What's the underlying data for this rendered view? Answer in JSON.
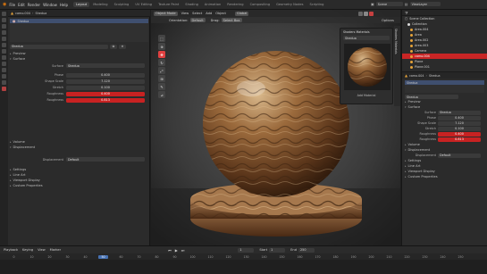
{
  "topbar": {
    "menus": [
      "File",
      "Edit",
      "Render",
      "Window",
      "Help"
    ],
    "workspaces": [
      "Layout",
      "Modeling",
      "Sculpting",
      "UV Editing",
      "Texture Paint",
      "Shading",
      "Animation",
      "Rendering",
      "Compositing",
      "Geometry Nodes",
      "Scripting"
    ],
    "active_workspace": "Layout",
    "scene": "Scene",
    "view_layer": "ViewLayer"
  },
  "left": {
    "object_name": "camo.004",
    "material_name": "Shedua",
    "material_field": "Shedua",
    "sections": {
      "preview": "Preview",
      "surface": "Surface",
      "volume": "Volume",
      "displacement": "Displacement",
      "settings": "Settings",
      "line_art": "Line Art",
      "viewport_display": "Viewport Display",
      "custom_properties": "Custom Properties"
    },
    "surface_label": "Surface",
    "surface_value": "Shedua",
    "props": [
      {
        "label": "Phase",
        "value": "0.400",
        "red": false
      },
      {
        "label": "Shape Scale",
        "value": "7.120",
        "red": false
      },
      {
        "label": "Stretch",
        "value": "0.100",
        "red": false
      },
      {
        "label": "Roughness",
        "value": "0.400",
        "red": true
      },
      {
        "label": "Roughness",
        "value": "0.813",
        "red": true
      }
    ],
    "displacement_label": "Displacement",
    "displacement_value": "Default"
  },
  "viewport": {
    "mode": "Object Mode",
    "menus": [
      "View",
      "Select",
      "Add",
      "Object"
    ],
    "orientation_label": "Orientation:",
    "orientation_value": "Default",
    "drag_label": "Drag:",
    "drag_value": "Select Box",
    "transform": "Global",
    "options": "Options",
    "popup": {
      "title": "Shaders Materials",
      "field": "Shedua",
      "caption": "Add Material"
    },
    "side_tab": "Shaders Materials"
  },
  "right": {
    "outliner_title": "Scene Collection",
    "items": [
      {
        "name": "Collection",
        "color": "#dcdcdc",
        "sel": false
      },
      {
        "name": "Area.004",
        "color": "#e7a43a",
        "sel": false
      },
      {
        "name": "Area",
        "color": "#e7a43a",
        "sel": false
      },
      {
        "name": "Area.002",
        "color": "#e7a43a",
        "sel": false
      },
      {
        "name": "Area.003",
        "color": "#e7a43a",
        "sel": false
      },
      {
        "name": "Camera",
        "color": "#e7a43a",
        "sel": false
      },
      {
        "name": "camo.004",
        "color": "#e7a43a",
        "sel": true
      },
      {
        "name": "Plane",
        "color": "#e7a43a",
        "sel": false
      },
      {
        "name": "Plane.001",
        "color": "#e7a43a",
        "sel": false
      }
    ],
    "object_name": "camo.004",
    "material_name": "Shedua",
    "material_field": "Shedua",
    "sections": {
      "preview": "Preview",
      "surface": "Surface",
      "volume": "Volume",
      "displacement": "Displacement",
      "settings": "Settings",
      "line_art": "Line Art",
      "viewport_display": "Viewport Display",
      "custom_properties": "Custom Properties"
    },
    "surface_label": "Surface",
    "surface_value": "Shedua",
    "props": [
      {
        "label": "Phase",
        "value": "0.400",
        "red": false
      },
      {
        "label": "Shape Scale",
        "value": "7.120",
        "red": false
      },
      {
        "label": "Stretch",
        "value": "0.100",
        "red": false
      },
      {
        "label": "Roughness",
        "value": "0.400",
        "red": true
      },
      {
        "label": "Roughness",
        "value": "0.813",
        "red": true
      }
    ],
    "displacement_label": "Displacement",
    "displacement_value": "Default"
  },
  "timeline": {
    "menus": [
      "Playback",
      "Keying",
      "View",
      "Marker"
    ],
    "frames": [
      "0",
      "10",
      "20",
      "30",
      "40",
      "50",
      "60",
      "70",
      "80",
      "90",
      "100",
      "110",
      "120",
      "130",
      "140",
      "150",
      "160",
      "170",
      "180",
      "190",
      "200",
      "210",
      "220",
      "230",
      "240",
      "250"
    ],
    "current_frame": "1",
    "start_label": "Start",
    "start": "1",
    "end_label": "End",
    "end": "250"
  },
  "colors": {
    "accent_red": "#c82222",
    "selection_blue": "#4772b3"
  }
}
